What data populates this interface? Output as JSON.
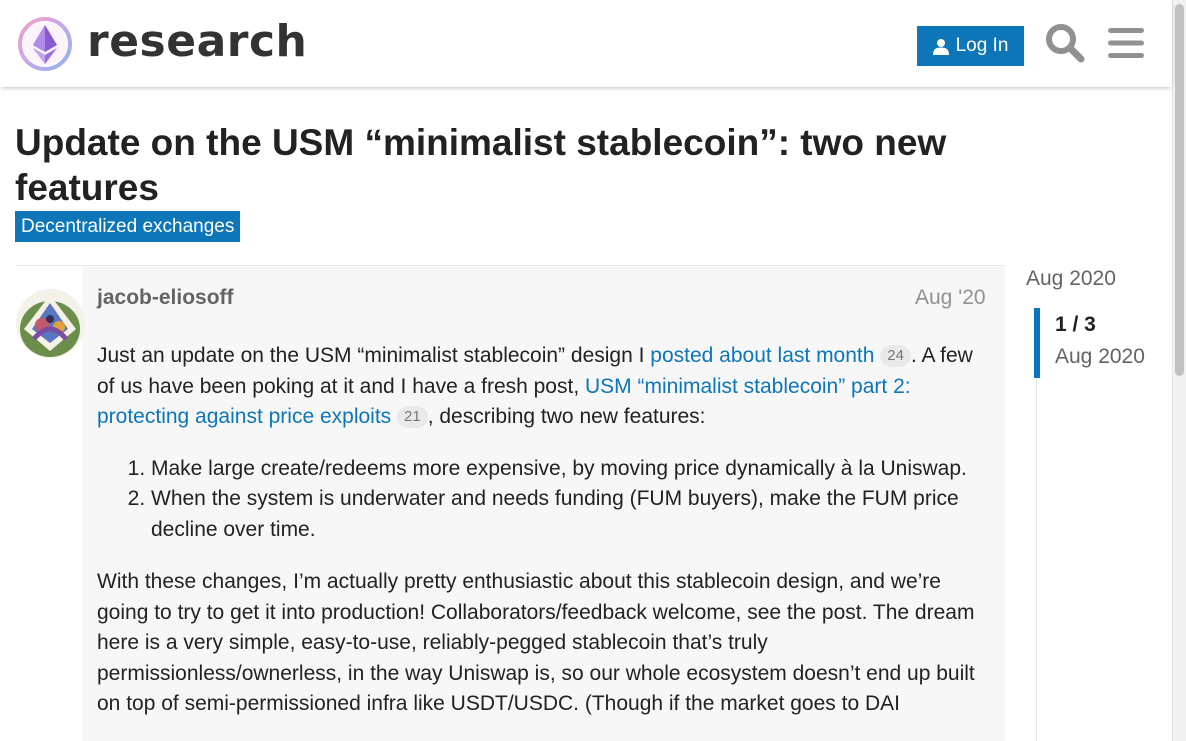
{
  "header": {
    "logo_text": "research",
    "login_label": "Log In",
    "search_icon": "search-icon",
    "menu_icon": "hamburger-menu-icon",
    "accent_color": "#0c76b9"
  },
  "topic": {
    "title": "Update on the USM “minimalist stablecoin”: two new features",
    "category": "Decentralized exchanges"
  },
  "post": {
    "username": "jacob-eliosoff",
    "date": "Aug '20",
    "p1_text_a": "Just an update on the USM “minimalist stablecoin” design I ",
    "p1_link1": "posted about last month",
    "p1_badge1": "24",
    "p1_text_b": ". A few of us have been poking at it and I have a fresh post, ",
    "p1_link2": "USM “minimalist stablecoin” part 2: protecting against price exploits",
    "p1_badge2": "21",
    "p1_text_c": ", describing two new features:",
    "list_items": [
      "Make large create/redeems more expensive, by moving price dynamically à la Uniswap.",
      "When the system is underwater and needs funding (FUM buyers), make the FUM price decline over time."
    ],
    "p2_text": "With these changes, I’m actually pretty enthusiastic about this stablecoin design, and we’re going to try to get it into production! Collaborators/feedback welcome, see the post. The dream here is a very simple, easy-to-use, reliably-pegged stablecoin that’s truly permissionless/ownerless, in the way Uniswap is, so our whole ecosystem doesn’t end up built on top of semi-permissioned infra like USDT/USDC. (Though if the market goes to DAI"
  },
  "timeline": {
    "top_date": "Aug 2020",
    "count": "1 / 3",
    "current_date": "Aug 2020"
  }
}
